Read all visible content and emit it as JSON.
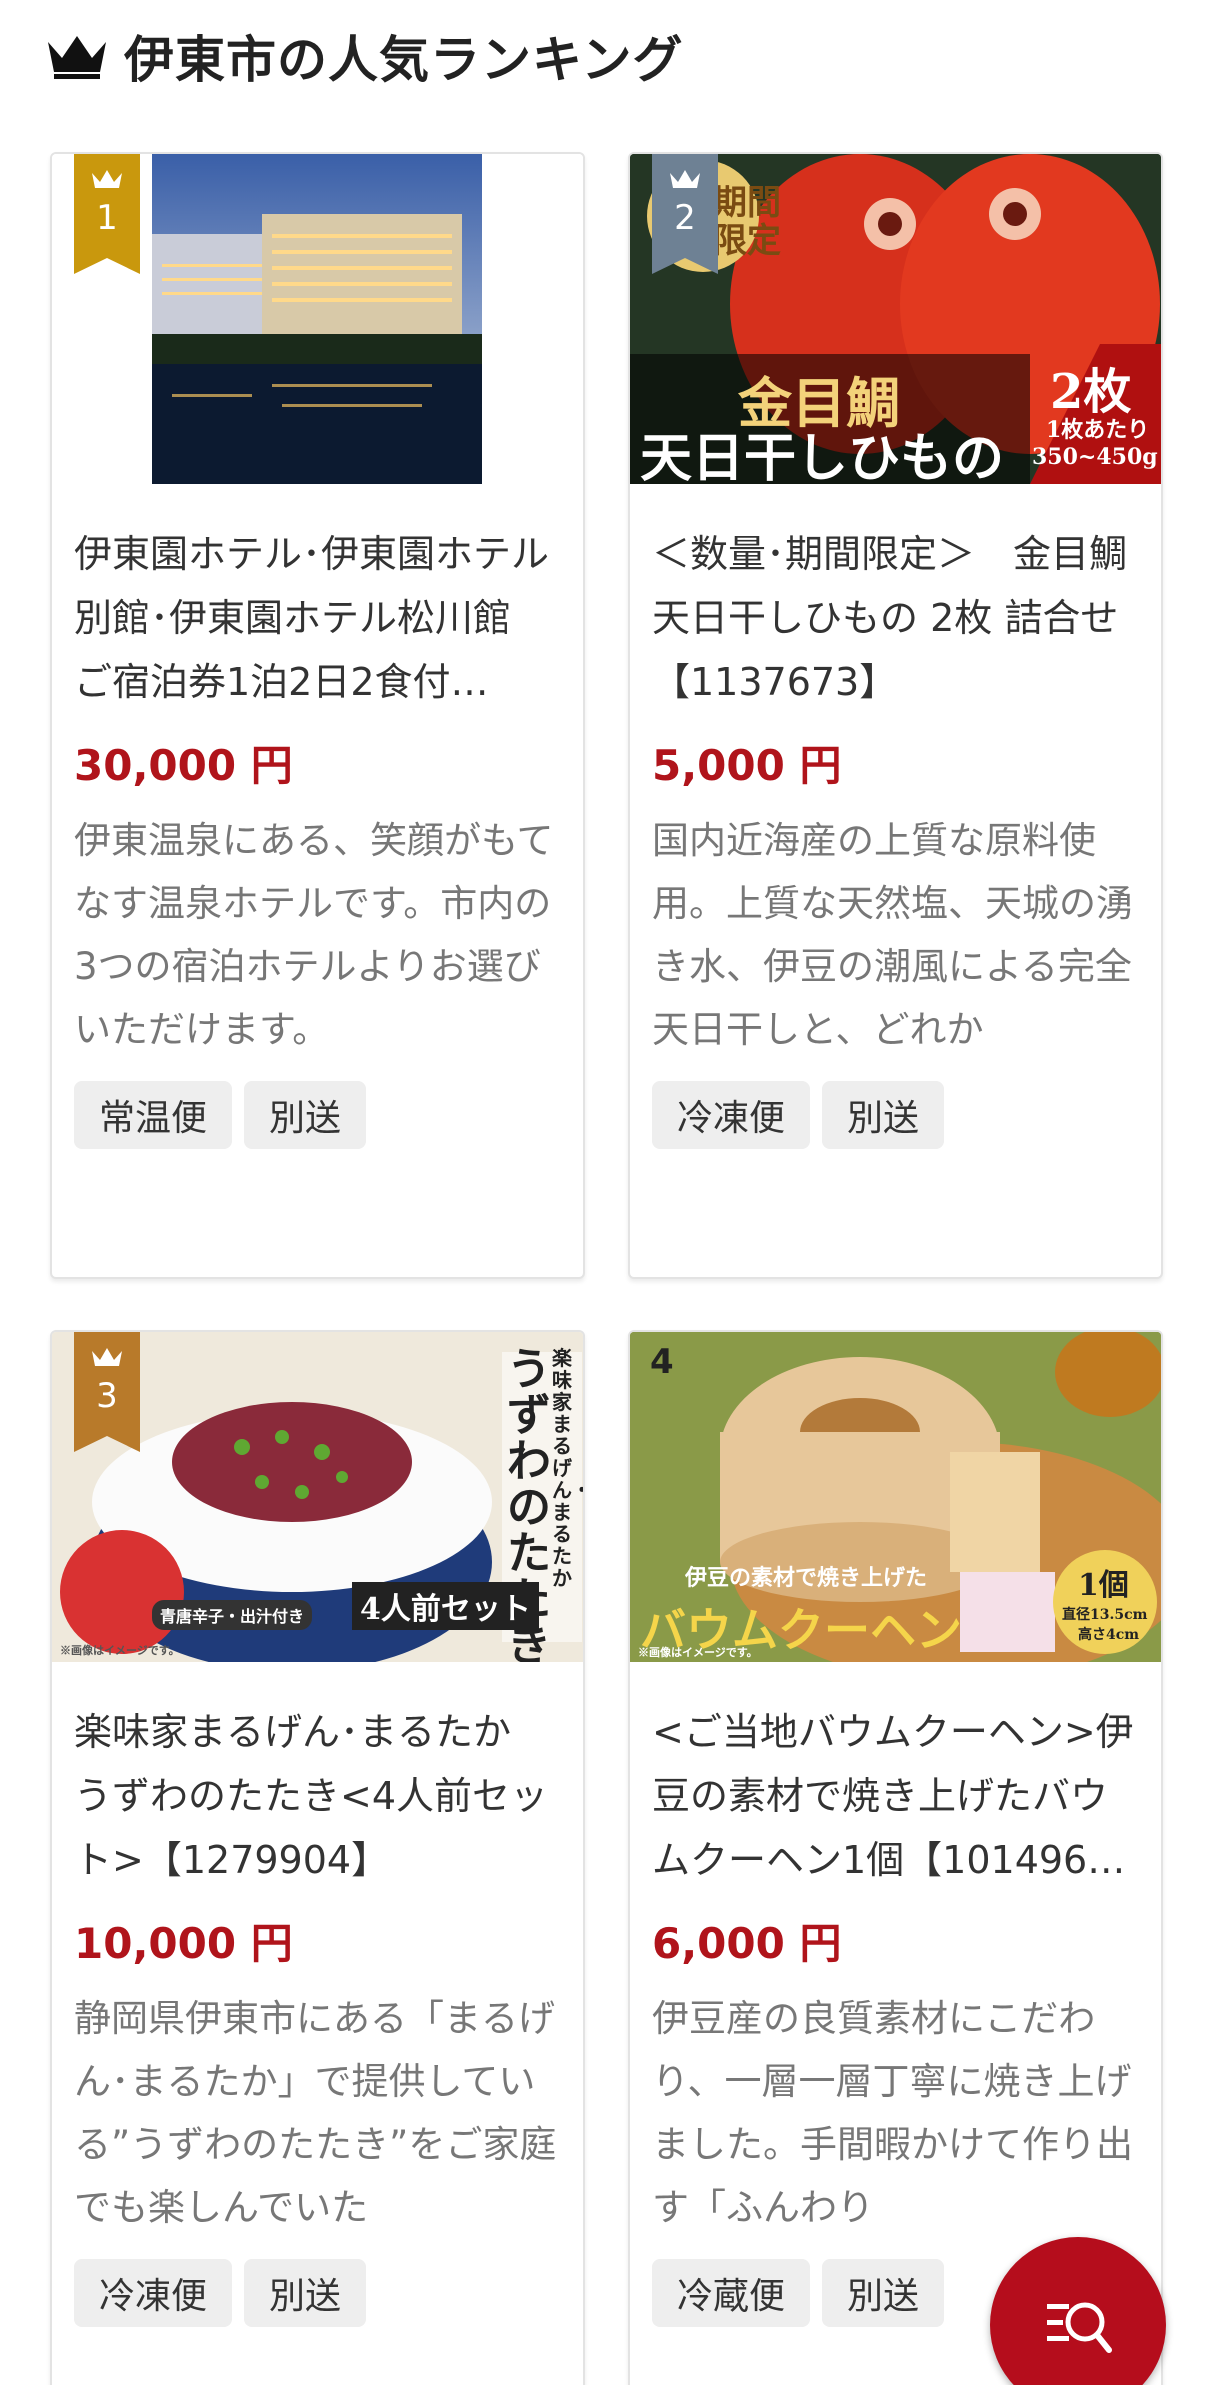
{
  "page": {
    "title": "伊東市の人気ランキング",
    "accent_color": "#b0141b"
  },
  "products": [
    {
      "rank": "1",
      "rank_color": "#c9980d",
      "name": "伊東園ホテル･伊東園ホテル別館･伊東園ホテル松川館　ご宿泊券1泊2日2食付…",
      "price": "30,000 円",
      "description": "伊東温泉にある、笑顔がもてなす温泉ホテルです。市内の3つの宿泊ホテルよりお選びいただけます。",
      "tags": [
        "常温便",
        "別送"
      ]
    },
    {
      "rank": "2",
      "rank_color": "#6e8194",
      "name": "＜数量･期間限定＞　金目鯛 天日干しひもの 2枚 詰合せ【1137673】",
      "price": "5,000 円",
      "description": "国内近海産の上質な原料使用。上質な天然塩、天城の湧き水、伊豆の潮風による完全天日干しと、どれか",
      "tags": [
        "冷凍便",
        "別送"
      ],
      "image_text": {
        "badge": "期間限定",
        "title1": "金目鯛",
        "title2": "天日干しひもの",
        "count": "2枚",
        "per": "1枚あたり",
        "weight": "350~450g"
      }
    },
    {
      "rank": "3",
      "rank_color": "#b87a2a",
      "name": "楽味家まるげん･まるたか　うずわのたたき<4人前セット>【1279904】",
      "price": "10,000 円",
      "description": "静岡県伊東市にある「まるげん･まるたか」で提供している”うずわのたたき”をご家庭でも楽しんでいた",
      "tags": [
        "冷凍便",
        "別送"
      ],
      "image_text": {
        "brand": "楽味家まるげん・まるたか",
        "title": "うずわのたたき",
        "set": "4人前セット",
        "side": "青唐辛子・出汁付き",
        "note": "※画像はイメージです。"
      }
    },
    {
      "rank": "4",
      "name": "<ご当地バウムクーヘン>伊豆の素材で焼き上げたバウムクーヘン1個【101496…",
      "price": "6,000 円",
      "description": "伊豆産の良質素材にこだわり、一層一層丁寧に焼き上げました。手間暇かけて作り出す「ふんわり",
      "tags": [
        "冷蔵便",
        "別送"
      ],
      "image_text": {
        "subtitle": "伊豆の素材で焼き上げた",
        "title": "バウムクーヘン",
        "count": "1個",
        "size1": "直径13.5cm",
        "size2": "高さ4cm",
        "note": "※画像はイメージです。"
      }
    }
  ],
  "fab": {
    "icon": "search-list-icon"
  }
}
